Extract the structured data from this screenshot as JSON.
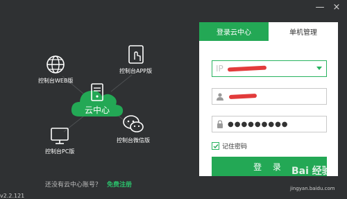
{
  "window": {
    "minimize_glyph": "—",
    "close_glyph": "×"
  },
  "left": {
    "center_label": "云中心",
    "nodes": {
      "web": "控制台WEB版",
      "app": "控制台APP版",
      "pc": "控制台PC版",
      "wechat": "控制台微信版"
    },
    "register_question": "还没有云中心账号？",
    "register_link": "免费注册",
    "version": "v2.2.121"
  },
  "login": {
    "tabs": [
      "登录云中心",
      "单机管理"
    ],
    "active_tab": 0,
    "ip_placeholder": "IP",
    "password_mask": "●●●●●●●●●",
    "remember_label": "记住密码",
    "remember_checked": true,
    "login_button": "登 录"
  },
  "watermark": {
    "text": "Bai 经验",
    "sub": "jingyan.baidu.com"
  },
  "colors": {
    "accent": "#23a855",
    "background": "#2f3133"
  }
}
